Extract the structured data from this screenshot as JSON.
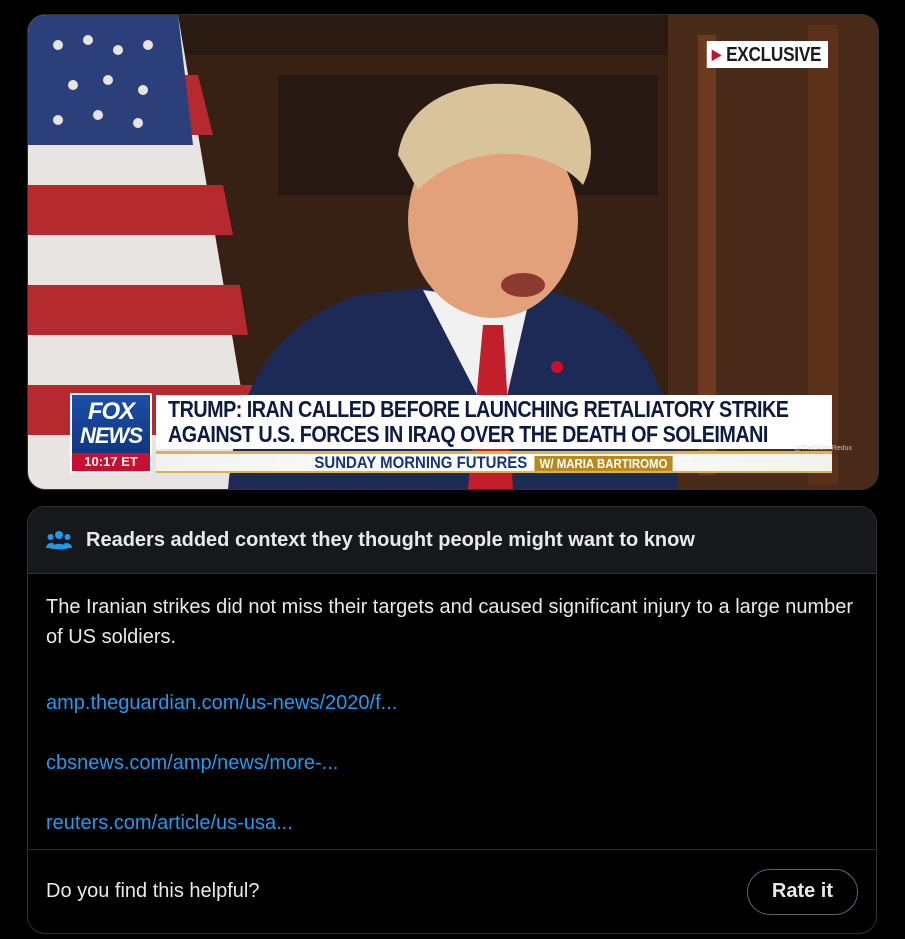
{
  "media": {
    "badge": "EXCLUSIVE",
    "logo_top": "FOX",
    "logo_bottom": "NEWS",
    "time": "10:17 ET",
    "headline_line1": "TRUMP: IRAN CALLED BEFORE LAUNCHING RETALIATORY STRIKE",
    "headline_line2": "AGAINST U.S. FORCES IN IRAQ OVER THE DEATH OF SOLEIMANI",
    "show_name": "SUNDAY MORNING FUTURES",
    "show_host": "W/ MARIA BARTIROMO",
    "watermark": "@TheStormRedux"
  },
  "note": {
    "header": "Readers added context they thought people might want to know",
    "body": "The Iranian strikes did not miss their targets and caused significant injury to a large number of US soldiers.",
    "links": [
      "amp.theguardian.com/us-news/2020/f...",
      "cbsnews.com/amp/news/more-...",
      "reuters.com/article/us-usa..."
    ],
    "question": "Do you find this helpful?",
    "rate_button": "Rate it"
  },
  "colors": {
    "background": "#000000",
    "link": "#1d9bf0",
    "text": "#e7e9ea",
    "border": "#2f3336",
    "fox_red": "#c8102e",
    "fox_blue": "#0d2f73"
  }
}
